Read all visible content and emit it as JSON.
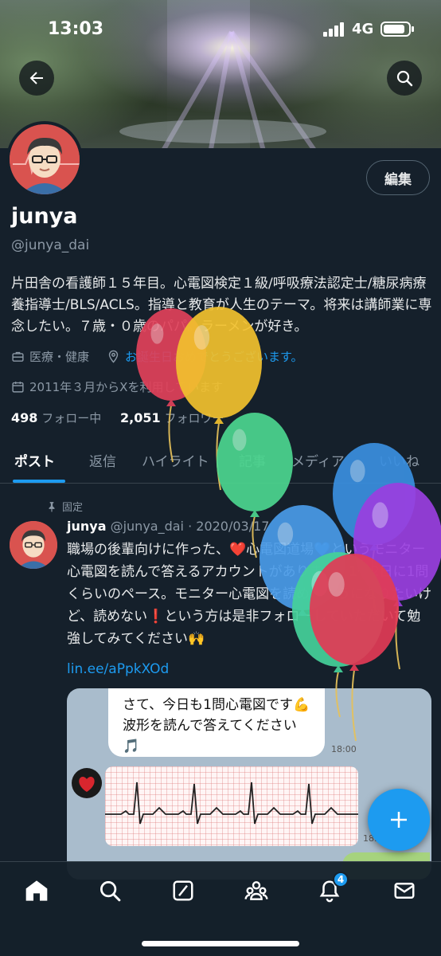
{
  "status_bar": {
    "time": "13:03",
    "network": "4G"
  },
  "profile": {
    "display_name": "junya",
    "handle": "@junya_dai",
    "edit_label": "編集",
    "bio": "片田舎の看護師１５年目。心電図検定１級/呼吸療法認定士/糖尿病療養指導士/BLS/ACLS。指導と教育が人生のテーマ。将来は講師業に専念したい。７歳・０歳のパパ。ラーメンが好き。",
    "category": "医療・健康",
    "birthday_text": "お誕生日おめでとうございます。",
    "joined": "2011年３月からXを利用しています",
    "following_count": "498",
    "following_label": "フォロー中",
    "followers_count": "2,051",
    "followers_label": "フォロワー"
  },
  "tabs": [
    {
      "label": "ポスト",
      "active": true
    },
    {
      "label": "返信"
    },
    {
      "label": "ハイライト"
    },
    {
      "label": "記事"
    },
    {
      "label": "メディア"
    },
    {
      "label": "いいね"
    }
  ],
  "pinned_tweet": {
    "pinned_label": "固定",
    "author_name": "junya",
    "author_handle": "@junya_dai",
    "date": "· 2020/03/17",
    "text": "職場の後輩向けに作った、❤️心電図道場💙というモニター心電図を読んで答えるアカウントがあります。1〜2日に1問くらいのペース。モニター心電図を読めるようになりたいけど、読めない❗️という方は是非フォローしていただいて勉強してみてください🙌",
    "link": "lin.ee/aPpkXOd",
    "media": {
      "bubble_text": "さて、今日も1問心電図です💪波形を読んで答えてください🎵",
      "bubble_time": "18:00",
      "ecg_time": "18:00"
    }
  },
  "bottom_nav": {
    "notification_badge": "4"
  },
  "icons": [
    "back-arrow-icon",
    "search-icon",
    "briefcase-icon",
    "location-pin-icon",
    "calendar-icon",
    "pin-icon",
    "compose-plus-icon",
    "home-icon",
    "explore-icon",
    "grok-icon",
    "communities-icon",
    "bell-icon",
    "mail-icon"
  ],
  "colors": {
    "background": "#15202b",
    "accent": "#1d9bf0",
    "text": "#e7e9ea",
    "muted": "#8b98a5"
  },
  "balloons": [
    {
      "color": "#e0415a"
    },
    {
      "color": "#f2c12e"
    },
    {
      "color": "#4cd68f"
    },
    {
      "color": "#3a8fe0"
    },
    {
      "color": "#4a9be8"
    },
    {
      "color": "#9a3fe0"
    },
    {
      "color": "#45d19a"
    },
    {
      "color": "#e23b56"
    }
  ]
}
